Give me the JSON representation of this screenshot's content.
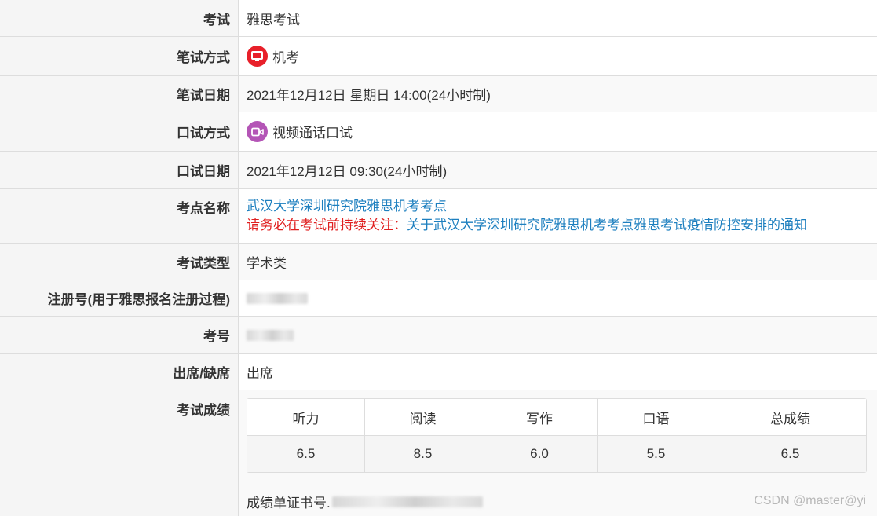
{
  "rows": {
    "exam": {
      "label": "考试",
      "value": "雅思考试"
    },
    "written_mode": {
      "label": "笔试方式",
      "value": "机考",
      "icon": "monitor-icon",
      "icon_color": "#e8202a"
    },
    "written_date": {
      "label": "笔试日期",
      "value": "2021年12月12日 星期日 14:00(24小时制)"
    },
    "speaking_mode": {
      "label": "口试方式",
      "value": "视频通话口试",
      "icon": "video-camera-icon",
      "icon_color": "#b455b6"
    },
    "speaking_date": {
      "label": "口试日期",
      "value": "2021年12月12日 09:30(24小时制)"
    },
    "test_center": {
      "label": "考点名称",
      "name": "武汉大学深圳研究院雅思机考考点",
      "notice_prefix": "请务必在考试前持续关注：",
      "notice_link": "关于武汉大学深圳研究院雅思机考考点雅思考试疫情防控安排的通知"
    },
    "exam_type": {
      "label": "考试类型",
      "value": "学术类"
    },
    "registration_no": {
      "label": "注册号(用于雅思报名注册过程)"
    },
    "candidate_no": {
      "label": "考号"
    },
    "attendance": {
      "label": "出席/缺席",
      "value": "出席"
    },
    "scores": {
      "label": "考试成绩",
      "headers": [
        "听力",
        "阅读",
        "写作",
        "口语",
        "总成绩"
      ],
      "values": [
        "6.5",
        "8.5",
        "6.0",
        "5.5",
        "6.5"
      ],
      "trf_label": "成绩单证书号."
    }
  },
  "colors": {
    "link": "#1d7fbf",
    "warning": "#e02020",
    "label_bg": "#f5f5f5"
  },
  "watermark": "CSDN @master@yi"
}
